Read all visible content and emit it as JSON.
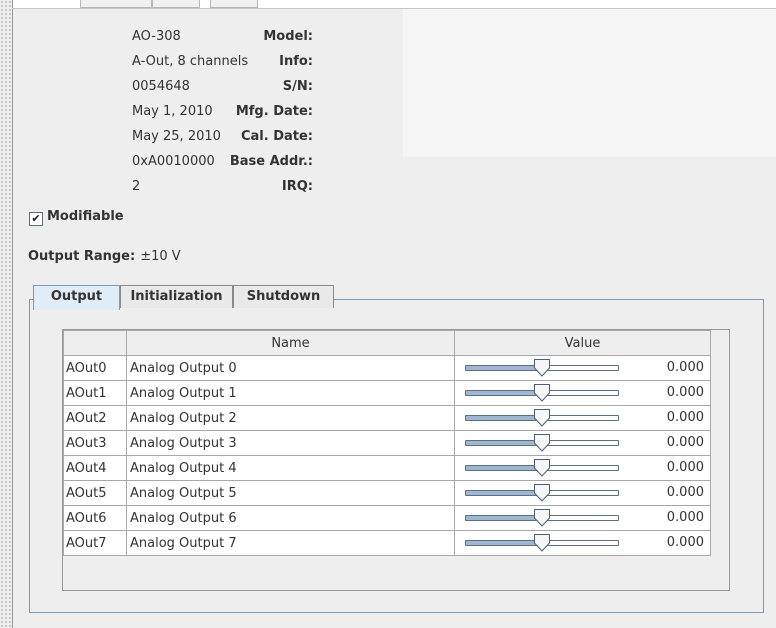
{
  "device": {
    "fields": [
      {
        "label": "Model:",
        "value": "AO-308"
      },
      {
        "label": "Info:",
        "value": "A-Out, 8 channels"
      },
      {
        "label": "S/N:",
        "value": "0054648"
      },
      {
        "label": "Mfg. Date:",
        "value": "May 1, 2010"
      },
      {
        "label": "Cal. Date:",
        "value": "May 25, 2010"
      },
      {
        "label": "Base Addr.:",
        "value": "0xA0010000"
      },
      {
        "label": "IRQ:",
        "value": "2"
      }
    ],
    "modifiable_label": "Modifiable",
    "modifiable_checked": true,
    "output_range_label": "Output Range:",
    "output_range_value": "±10 V"
  },
  "tabs": [
    "Output",
    "Initialization",
    "Shutdown"
  ],
  "active_tab": "Output",
  "table": {
    "columns": [
      "",
      "Name",
      "Value"
    ],
    "rows": [
      {
        "id": "AOut0",
        "name": "Analog Output 0",
        "value": "0.000",
        "slider_fraction": 0.5
      },
      {
        "id": "AOut1",
        "name": "Analog Output 1",
        "value": "0.000",
        "slider_fraction": 0.5
      },
      {
        "id": "AOut2",
        "name": "Analog Output 2",
        "value": "0.000",
        "slider_fraction": 0.5
      },
      {
        "id": "AOut3",
        "name": "Analog Output 3",
        "value": "0.000",
        "slider_fraction": 0.5
      },
      {
        "id": "AOut4",
        "name": "Analog Output 4",
        "value": "0.000",
        "slider_fraction": 0.5
      },
      {
        "id": "AOut5",
        "name": "Analog Output 5",
        "value": "0.000",
        "slider_fraction": 0.5
      },
      {
        "id": "AOut6",
        "name": "Analog Output 6",
        "value": "0.000",
        "slider_fraction": 0.5
      },
      {
        "id": "AOut7",
        "name": "Analog Output 7",
        "value": "0.000",
        "slider_fraction": 0.5
      }
    ]
  },
  "colors": {
    "accent_border": "#7a99b8",
    "active_tab": "#e0ecf6",
    "slider_fill": "#9fb8d0"
  }
}
